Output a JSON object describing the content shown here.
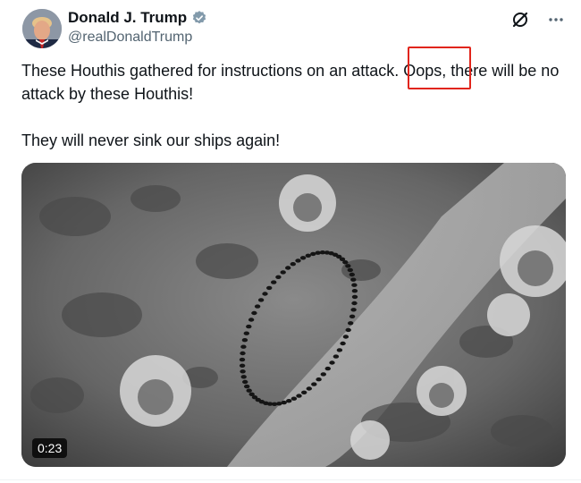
{
  "author": {
    "name": "Donald J. Trump",
    "handle": "@realDonaldTrump",
    "verified": true,
    "avatar_icon": "profile-photo"
  },
  "header_icons": [
    "grok-icon",
    "more-icon"
  ],
  "post": {
    "paragraph_1": "These Houthis gathered for instructions on an attack. Oops, there will be no attack by these Houthis!",
    "paragraph_2": "They will never sink our ships again!"
  },
  "media": {
    "type": "video",
    "duration": "0:23"
  },
  "colors": {
    "text": "#0f1419",
    "secondary": "#536471",
    "verified": "#1d9bf0",
    "highlight_box": "#e1251b"
  }
}
